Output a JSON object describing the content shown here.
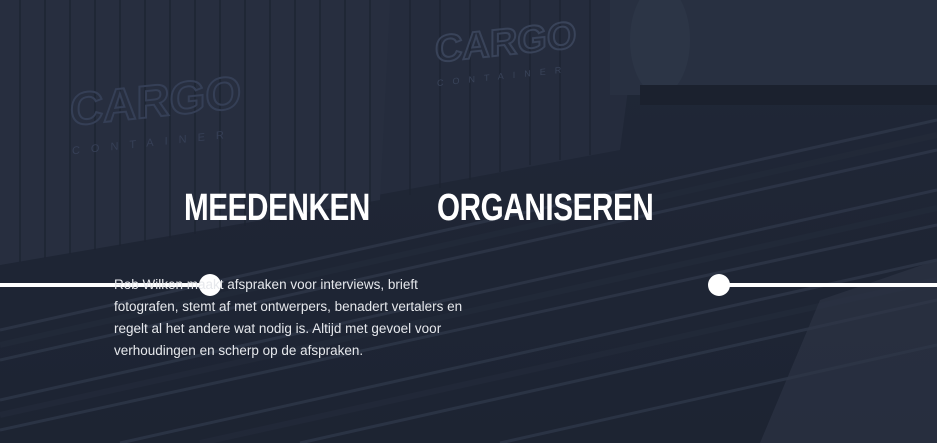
{
  "hero": {
    "background_label": "cargo train background",
    "container_text_1": "CARGO",
    "container_sub_1": "CONTAINER",
    "container_text_2": "CARGO",
    "container_sub_2": "CONTAINER"
  },
  "nav": {
    "item_1": "MEEDENKEN",
    "item_2": "ORGANISEREN"
  },
  "content": {
    "description": "Rob Wilken maakt afspraken voor interviews, brieft fotografen, stemt af met ontwerpers, benadert vertalers en regelt al het andere wat nodig is. Altijd met gevoel voor verhoudingen en scherp op de afspraken."
  },
  "colors": {
    "background": "#242c3b",
    "text": "#ffffff",
    "accent": "#ffffff"
  }
}
